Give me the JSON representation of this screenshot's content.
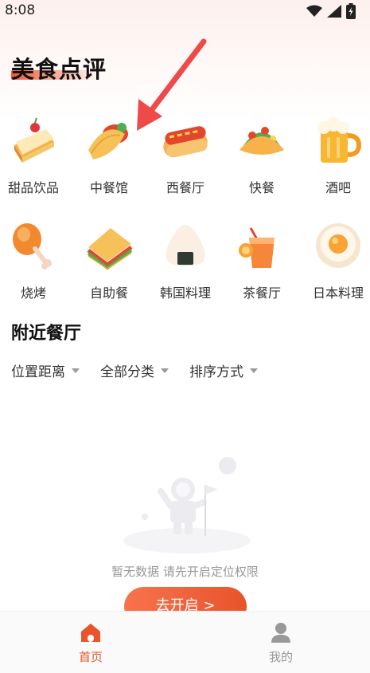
{
  "status_bar": {
    "time": "8:08"
  },
  "page_title": "美食点评",
  "categories": [
    {
      "label": "甜品饮品",
      "icon": "cake-icon"
    },
    {
      "label": "中餐馆",
      "icon": "taco-wrap-icon"
    },
    {
      "label": "西餐厅",
      "icon": "hotdog-icon"
    },
    {
      "label": "快餐",
      "icon": "taco-icon"
    },
    {
      "label": "酒吧",
      "icon": "beer-icon"
    },
    {
      "label": "烧烤",
      "icon": "chicken-leg-icon"
    },
    {
      "label": "自助餐",
      "icon": "sandwich-icon"
    },
    {
      "label": "韩国料理",
      "icon": "rice-ball-icon"
    },
    {
      "label": "茶餐厅",
      "icon": "juice-icon"
    },
    {
      "label": "日本料理",
      "icon": "fried-egg-icon"
    }
  ],
  "nearby": {
    "title": "附近餐厅",
    "filters": [
      {
        "label": "位置距离"
      },
      {
        "label": "全部分类"
      },
      {
        "label": "排序方式"
      }
    ],
    "empty_text": "暂无数据 请先开启定位权限",
    "cta_label": "去开启 >"
  },
  "tabbar": {
    "tabs": [
      {
        "label": "首页",
        "icon": "home-icon",
        "active": true
      },
      {
        "label": "我的",
        "icon": "user-icon",
        "active": false
      }
    ]
  },
  "colors": {
    "accent": "#e8542c",
    "arrow": "#ee4a4a"
  }
}
